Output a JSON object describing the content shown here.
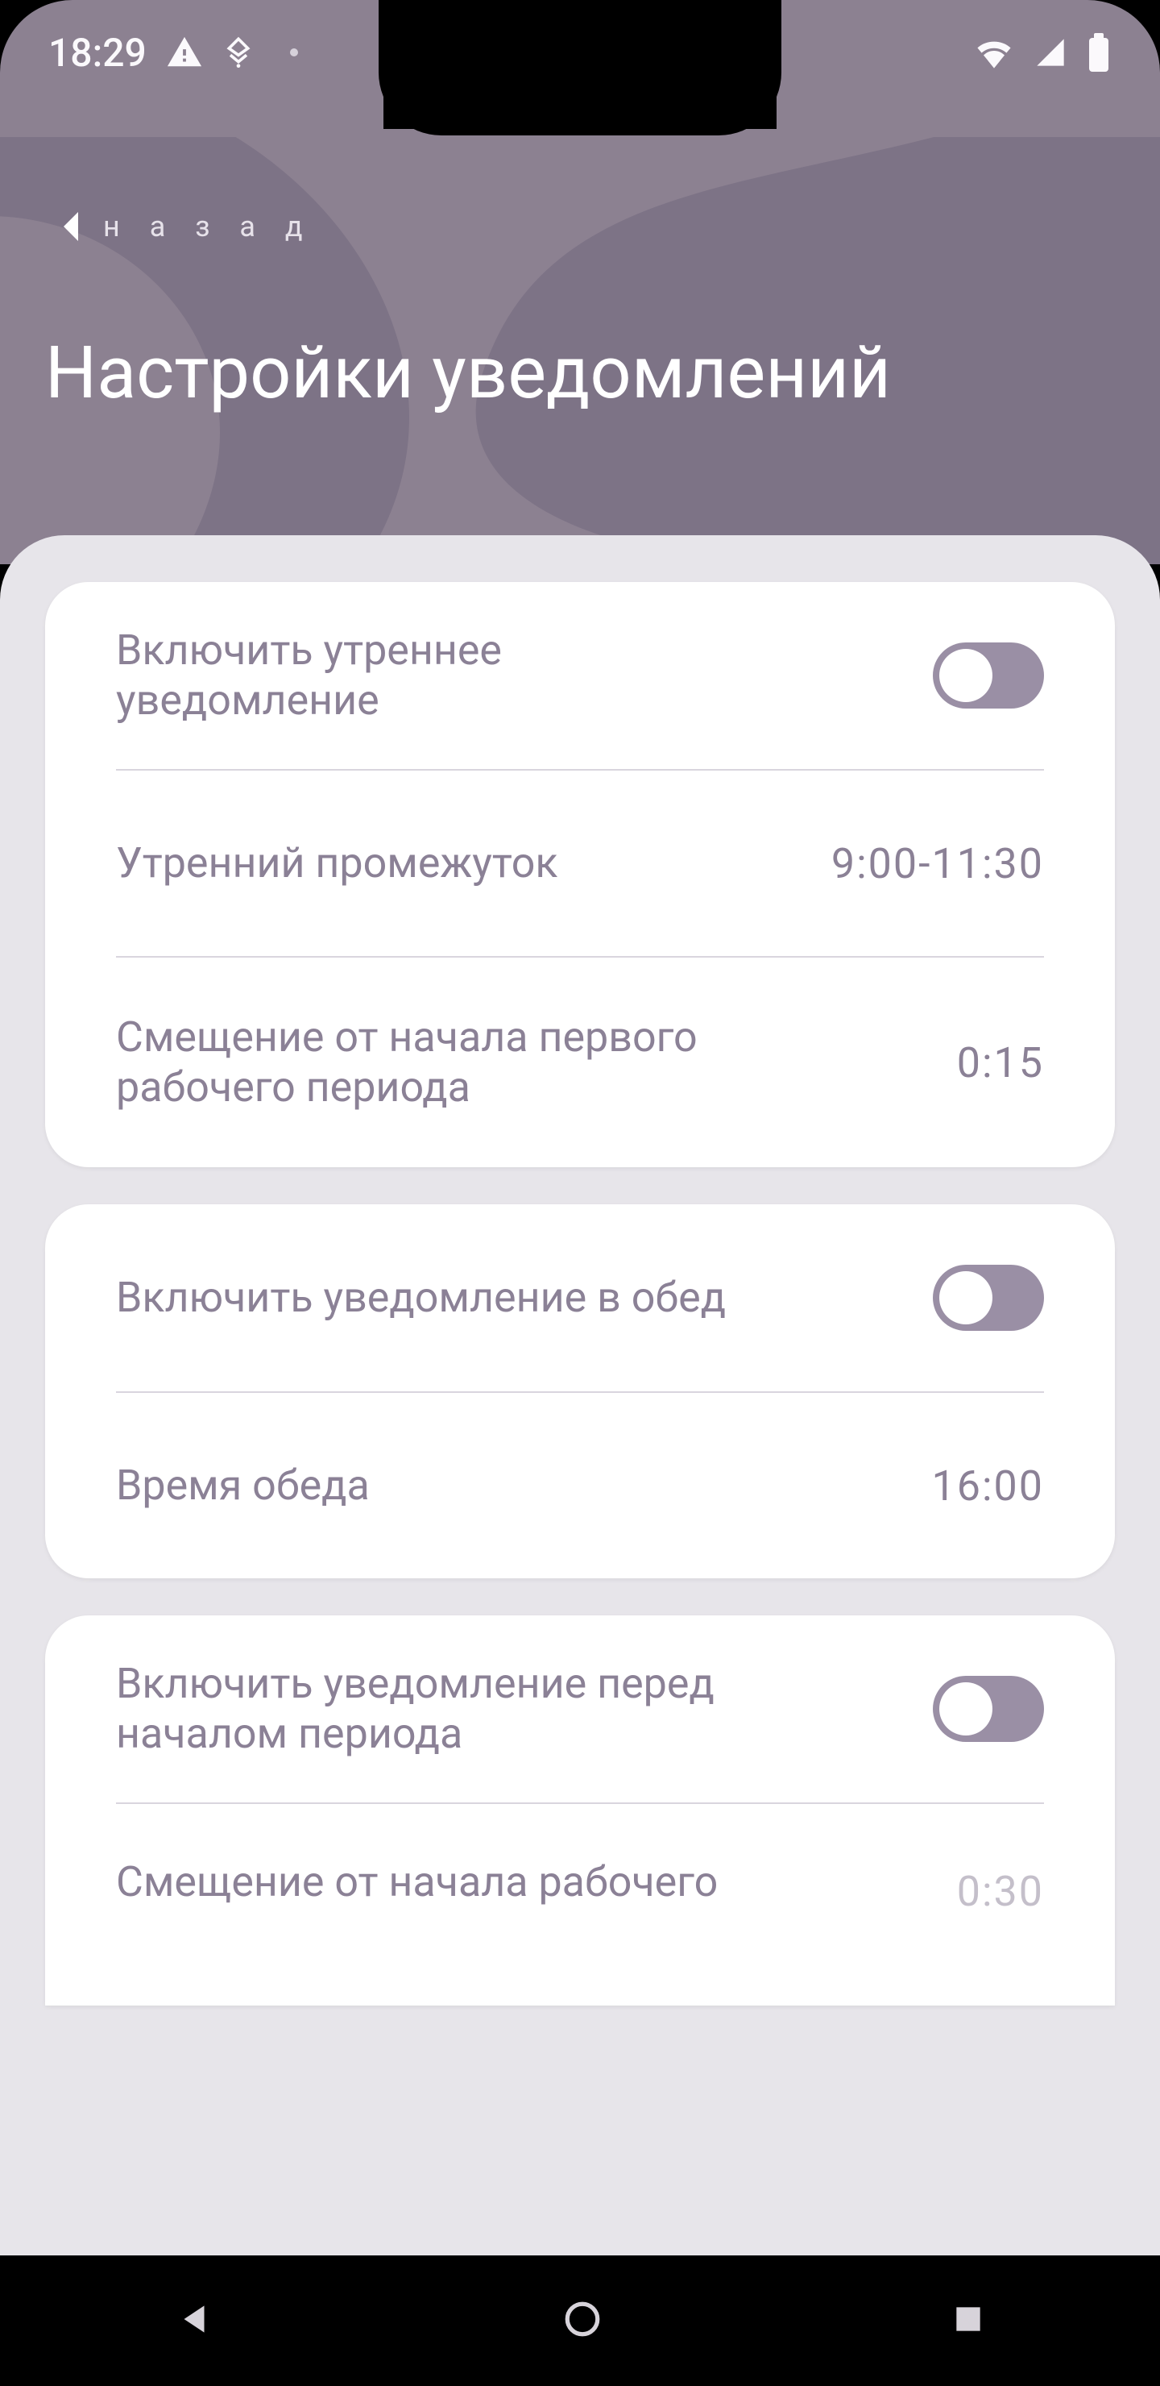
{
  "status": {
    "time": "18:29"
  },
  "header": {
    "back": "н а з а д",
    "title": "Настройки уведомлений"
  },
  "groups": {
    "morning": {
      "toggle_label": "Включить утреннее уведомление",
      "toggle_on": true,
      "interval_label": "Утренний промежуток",
      "interval_value": "9:00-11:30",
      "offset_label": "Смещение от начала первого рабочего периода",
      "offset_value": "0:15"
    },
    "lunch": {
      "toggle_label": "Включить уведомление в обед",
      "toggle_on": true,
      "time_label": "Время обеда",
      "time_value": "16:00"
    },
    "period": {
      "toggle_label": "Включить уведомление перед началом периода",
      "toggle_on": true,
      "offset_label": "Смещение от начала рабочего",
      "offset_value": "0:30"
    }
  },
  "colors": {
    "header_bg": "#8c8191",
    "swirl": "#7c7284",
    "sheet_bg": "#e7e5ea",
    "text_muted": "#8b8196",
    "toggle_bg": "#9a8fa5"
  }
}
